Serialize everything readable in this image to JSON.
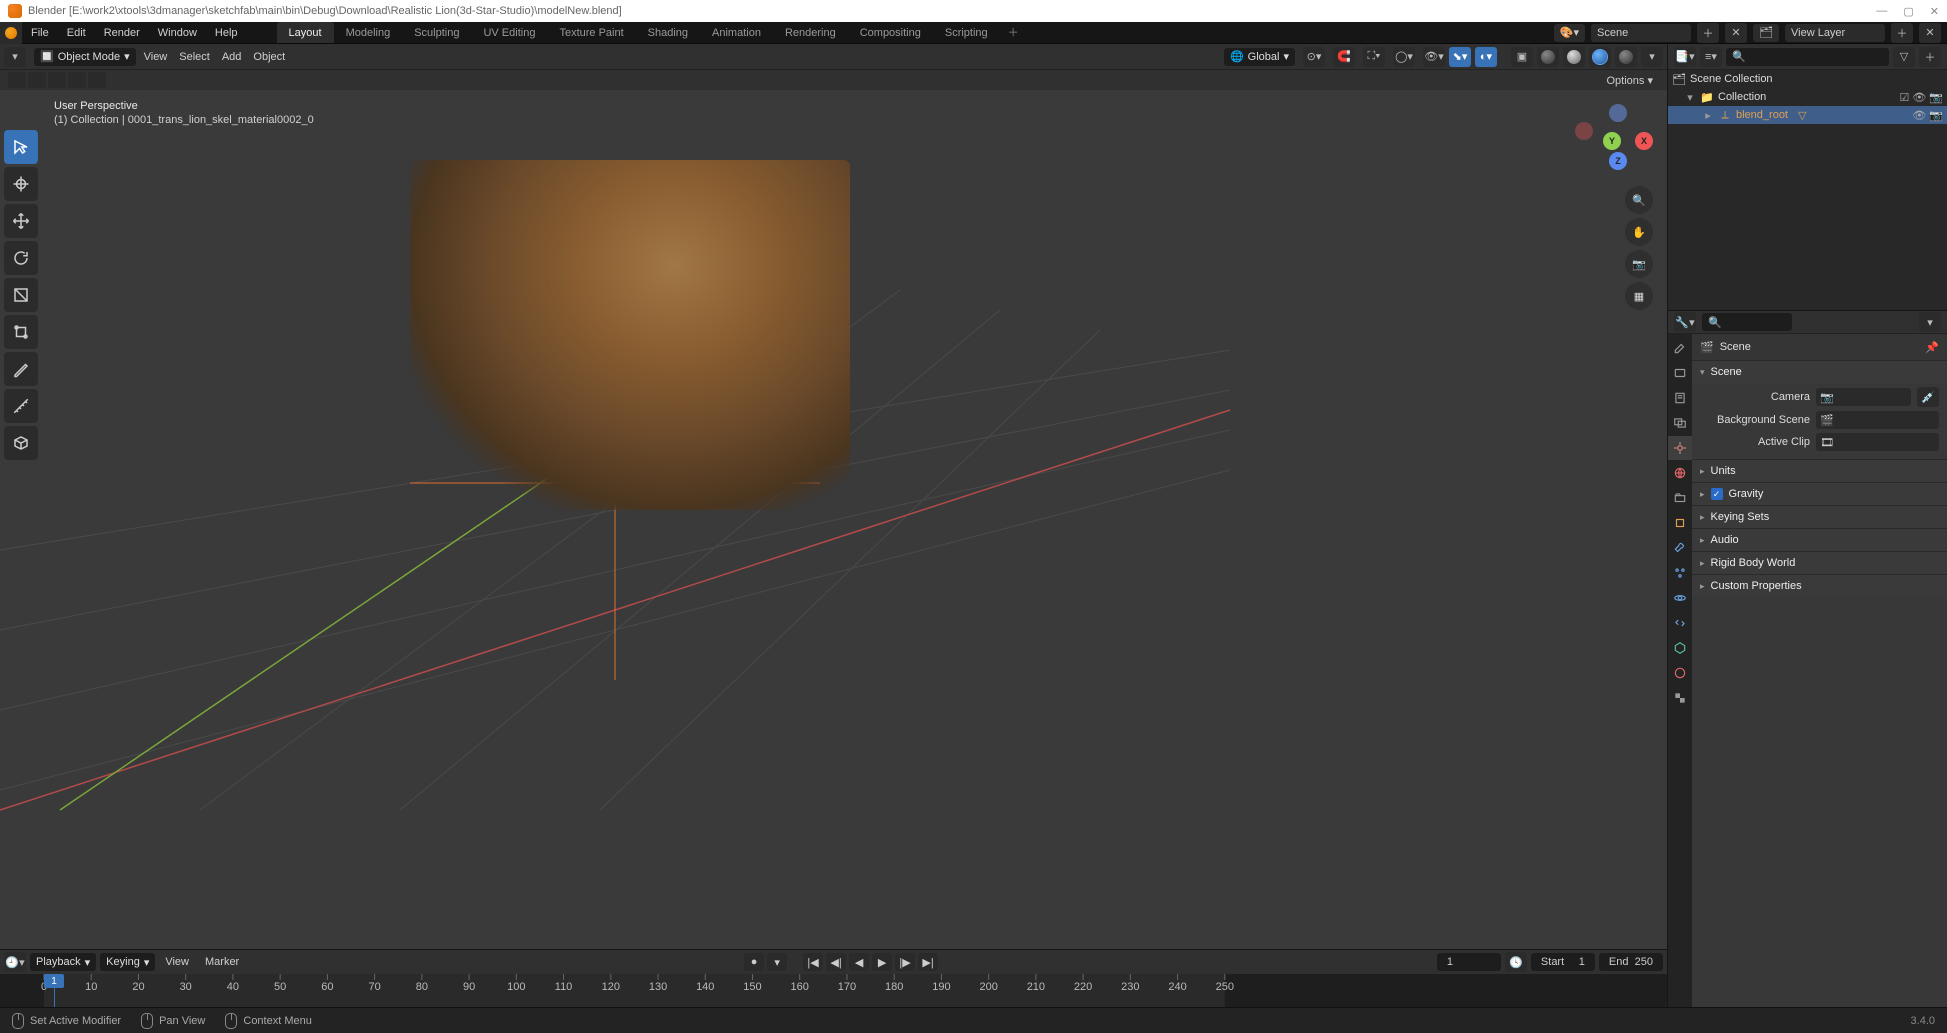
{
  "window_title": "Blender  [E:\\work2\\xtools\\3dmanager\\sketchfab\\main\\bin\\Debug\\Download\\Realistic Lion(3d-Star-Studio)\\modelNew.blend]",
  "main_menu": [
    "File",
    "Edit",
    "Render",
    "Window",
    "Help"
  ],
  "workspace_tabs": [
    "Layout",
    "Modeling",
    "Sculpting",
    "UV Editing",
    "Texture Paint",
    "Shading",
    "Animation",
    "Rendering",
    "Compositing",
    "Scripting"
  ],
  "active_workspace": "Layout",
  "scene_name": "Scene",
  "view_layer_name": "View Layer",
  "viewport": {
    "mode": "Object Mode",
    "header_menus": [
      "View",
      "Select",
      "Add",
      "Object"
    ],
    "orientation": "Global",
    "options_label": "Options",
    "overlay_title": "User Perspective",
    "overlay_sub": "(1) Collection | 0001_trans_lion_skel_material0002_0"
  },
  "outliner": {
    "root": "Scene Collection",
    "collection": "Collection",
    "item": "blend_root"
  },
  "properties": {
    "breadcrumb": "Scene",
    "panel_scene": "Scene",
    "label_camera": "Camera",
    "label_bgscene": "Background Scene",
    "label_activeclip": "Active Clip",
    "panels_collapsed": [
      "Units",
      "Gravity",
      "Keying Sets",
      "Audio",
      "Rigid Body World",
      "Custom Properties"
    ]
  },
  "timeline": {
    "menus": [
      "Playback",
      "Keying",
      "View",
      "Marker"
    ],
    "current": "1",
    "start_label": "Start",
    "start": "1",
    "end_label": "End",
    "end": "250",
    "ticks": [
      "0",
      "10",
      "20",
      "30",
      "40",
      "50",
      "60",
      "70",
      "80",
      "90",
      "100",
      "110",
      "120",
      "130",
      "140",
      "150",
      "160",
      "170",
      "180",
      "190",
      "200",
      "210",
      "220",
      "230",
      "240",
      "250"
    ]
  },
  "statusbar": {
    "left": "Set Active Modifier",
    "middle": "Pan View",
    "right": "Context Menu",
    "version": "3.4.0"
  }
}
